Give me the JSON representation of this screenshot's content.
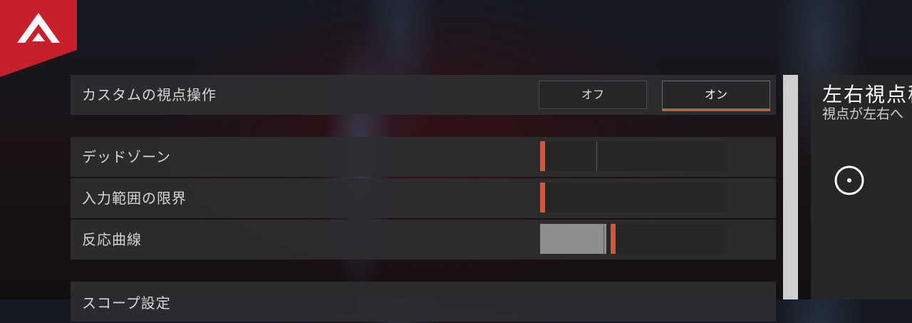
{
  "settings": {
    "custom_look": {
      "label": "カスタムの視点操作",
      "options": [
        "オフ",
        "オン"
      ],
      "selected": "オン"
    },
    "deadzone": {
      "label": "デッドゾーン",
      "value": 0.01
    },
    "outer_threshold": {
      "label": "入力範囲の限界",
      "value": 0.01
    },
    "response_curve": {
      "label": "反応曲線",
      "value": 0.4
    },
    "scope_section": {
      "label": "スコープ設定"
    }
  },
  "detail_panel": {
    "title": "左右視点移",
    "description": "視点が左右へ"
  },
  "colors": {
    "accent": "#d4553d",
    "logo_red": "#c8202a"
  },
  "icons": {
    "logo": "apex-legends-logo-icon",
    "stick": "analog-stick-icon"
  }
}
